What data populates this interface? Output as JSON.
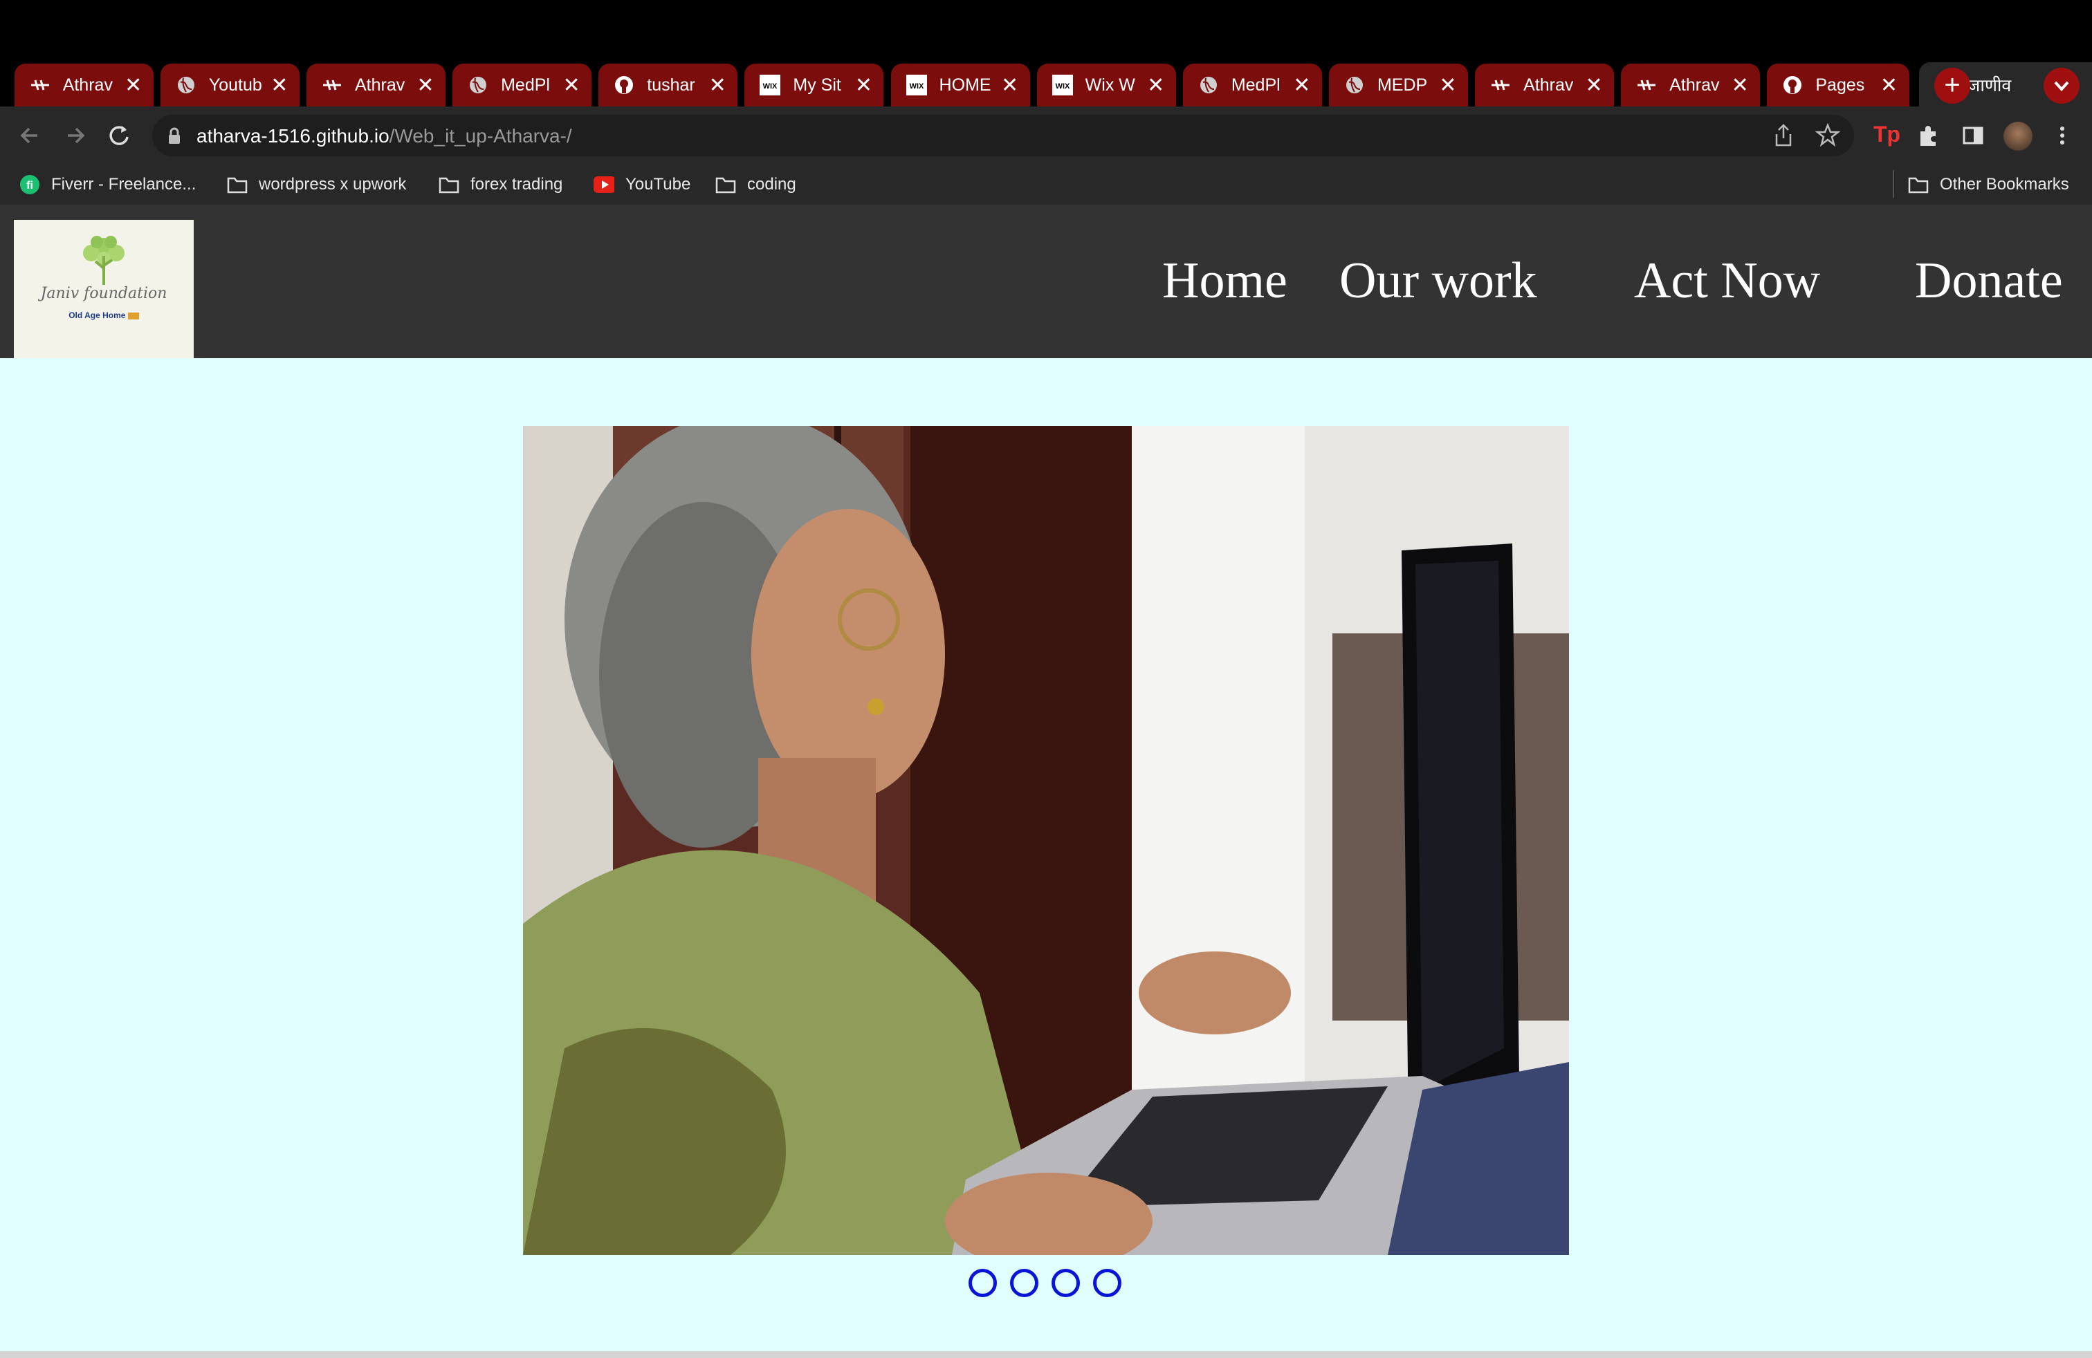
{
  "browser": {
    "tabs": [
      {
        "title": "Athrav",
        "favicon": "athrav-icon"
      },
      {
        "title": "Youtub",
        "favicon": "globe-icon"
      },
      {
        "title": "Athrav",
        "favicon": "athrav-icon"
      },
      {
        "title": "MedPl",
        "favicon": "globe-icon"
      },
      {
        "title": "tushar",
        "favicon": "github-icon"
      },
      {
        "title": "My Sit",
        "favicon": "wix-icon"
      },
      {
        "title": "HOME",
        "favicon": "wix-icon"
      },
      {
        "title": "Wix W",
        "favicon": "wix-icon"
      },
      {
        "title": "MedPl",
        "favicon": "globe-icon"
      },
      {
        "title": "MEDP",
        "favicon": "globe-icon"
      },
      {
        "title": "Athrav",
        "favicon": "athrav-icon"
      },
      {
        "title": "Athrav",
        "favicon": "athrav-icon"
      },
      {
        "title": "Pages",
        "favicon": "github-icon"
      },
      {
        "title": "जाणीव",
        "favicon": "globe-icon",
        "active": true
      }
    ],
    "url_host": "atharva-1516.github.io",
    "url_path": "/Web_it_up-Atharva-/",
    "bookmarks": [
      {
        "label": "Fiverr - Freelance...",
        "icon": "fiverr-icon"
      },
      {
        "label": "wordpress x upwork",
        "icon": "folder-icon"
      },
      {
        "label": "forex trading",
        "icon": "folder-icon"
      },
      {
        "label": "YouTube",
        "icon": "youtube-icon"
      },
      {
        "label": "coding",
        "icon": "folder-icon"
      }
    ],
    "other_bookmarks": "Other Bookmarks",
    "wix_label": "WIX"
  },
  "site": {
    "logo": {
      "name": "Janiv foundation",
      "subtitle": "Old Age Home"
    },
    "nav": [
      "Home",
      "Our work",
      "Act Now",
      "Donate"
    ],
    "slider_dots": 4
  },
  "colors": {
    "tab": "#7b0d0d",
    "header": "#333333",
    "page_bg": "#e0fefe",
    "dot": "#0a14d6"
  }
}
